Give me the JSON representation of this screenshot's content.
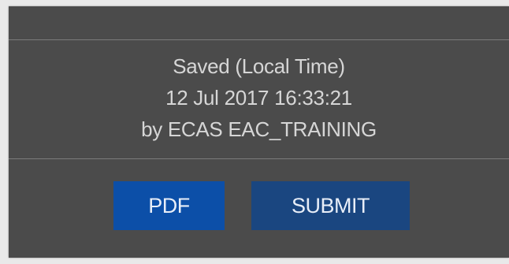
{
  "save_info": {
    "status_line": "Saved (Local Time)",
    "timestamp": "12 Jul 2017 16:33:21",
    "author_line": "by ECAS EAC_TRAINING"
  },
  "actions": {
    "pdf_label": "PDF",
    "submit_label": "SUBMIT"
  },
  "colors": {
    "panel_background": "#4b4b4b",
    "divider": "#7b7b7b",
    "text": "#d6d6d6",
    "pdf_button": "#0c4fa8",
    "submit_button": "#1a4680"
  }
}
